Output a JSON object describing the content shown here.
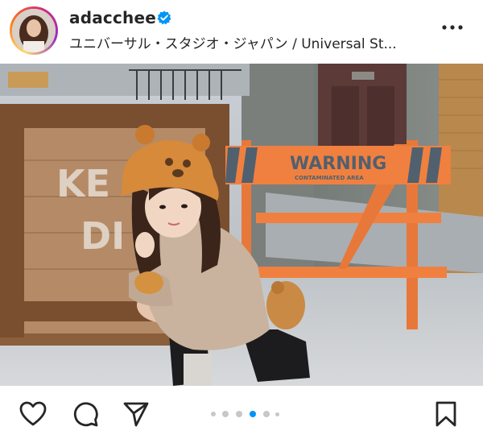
{
  "post": {
    "username": "adacchee",
    "location": "ユニバーサル・スタジオ・ジャパン / Universal St...",
    "photo_texts": {
      "crate_line1": "KE",
      "crate_line2": "DI",
      "sign_main": "WARNING",
      "sign_sub": "CONTAMINATED AREA"
    },
    "carousel": {
      "total": 6,
      "active_index": 3
    }
  },
  "colors": {
    "verified": "#0095f6",
    "carousel_active": "#0095f6",
    "carousel_inactive": "#c7c7c7",
    "sign_orange": "#f08040"
  },
  "icons": {
    "more": "more-horizontal-icon",
    "like": "heart-icon",
    "comment": "comment-bubble-icon",
    "share": "paper-plane-icon",
    "save": "bookmark-icon",
    "verified": "verified-badge-icon"
  }
}
